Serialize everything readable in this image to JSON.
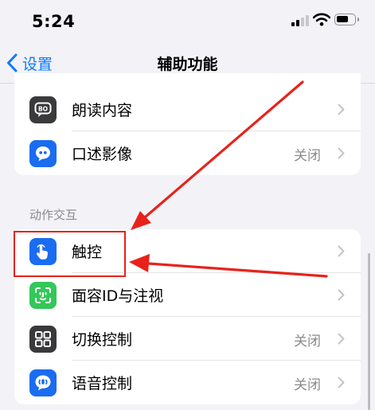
{
  "status": {
    "time": "5:24"
  },
  "nav": {
    "back_label": "设置",
    "title": "辅助功能"
  },
  "group_top": {
    "items": [
      {
        "label": "朗读内容",
        "value": "",
        "icon": "speech-bubble-icon",
        "icon_color": "#3a3a3c"
      },
      {
        "label": "口述影像",
        "value": "关闭",
        "icon": "quote-bubble-icon",
        "icon_color": "#1a6cf0"
      }
    ]
  },
  "section_motion": {
    "header": "动作交互",
    "items": [
      {
        "label": "触控",
        "value": "",
        "icon": "hand-touch-icon",
        "icon_color": "#1a6cf0"
      },
      {
        "label": "面容ID与注视",
        "value": "",
        "icon": "face-id-icon",
        "icon_color": "#34c759"
      },
      {
        "label": "切换控制",
        "value": "关闭",
        "icon": "grid-icon",
        "icon_color": "#3a3a3c"
      },
      {
        "label": "语音控制",
        "value": "关闭",
        "icon": "voice-control-icon",
        "icon_color": "#1a6cf0"
      }
    ]
  },
  "colors": {
    "accent": "#0a7aff",
    "annotation": "#e8221a"
  }
}
